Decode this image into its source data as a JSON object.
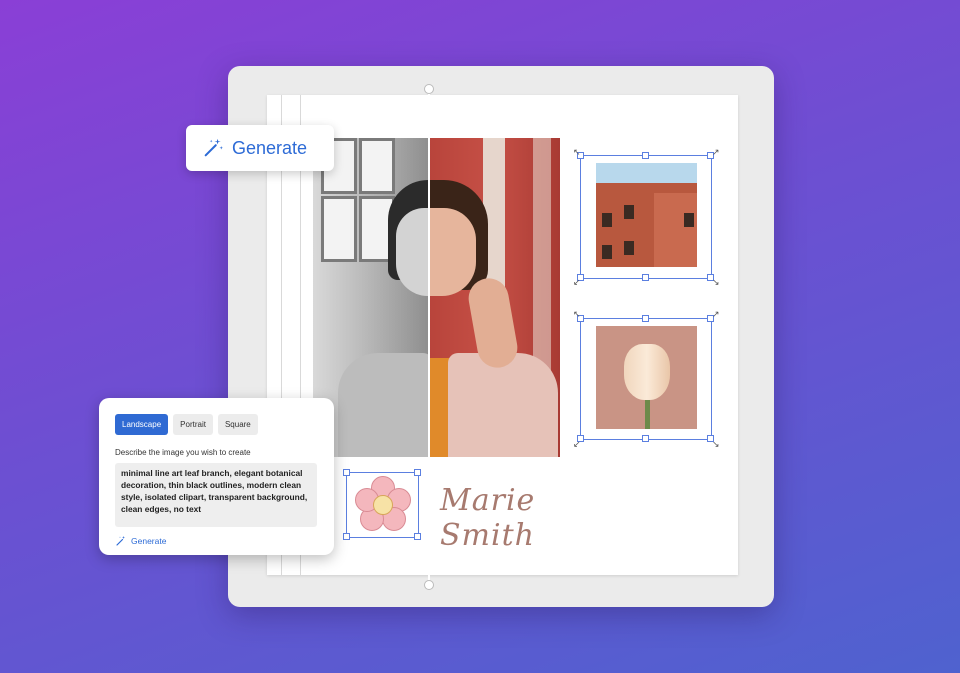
{
  "generate_button": {
    "label": "Generate",
    "icon": "magic-wand-icon"
  },
  "prompt_panel": {
    "tabs": [
      {
        "label": "Landscape",
        "active": true
      },
      {
        "label": "Portrait",
        "active": false
      },
      {
        "label": "Square",
        "active": false
      }
    ],
    "description_label": "Describe the image you wish to create",
    "prompt_text": "minimal line art leaf branch, elegant botanical decoration, thin black outlines, modern clean style, isolated clipart, transparent background, clean edges, no text",
    "generate_label": "Generate"
  },
  "page": {
    "signature_text": "Marie Smith"
  },
  "colors": {
    "accent": "#2d6bd6",
    "tab_active": "#2f6ad3",
    "selection": "#5b7fe0"
  }
}
